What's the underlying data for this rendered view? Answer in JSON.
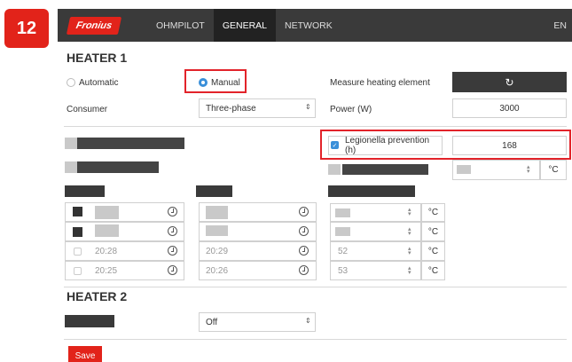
{
  "step_number": "12",
  "nav": {
    "logo": "Fronius",
    "tabs": [
      "OHMPILOT",
      "GENERAL",
      "NETWORK"
    ],
    "active_tab": "GENERAL",
    "language": "EN"
  },
  "heater1": {
    "title": "HEATER 1",
    "mode_automatic_label": "Automatic",
    "mode_manual_label": "Manual",
    "selected_mode": "Manual",
    "measure_label": "Measure heating element",
    "consumer_label": "Consumer",
    "consumer_value": "Three-phase",
    "power_label": "Power (W)",
    "power_value": "3000",
    "legionella_label": "Legionella prevention (h)",
    "legionella_value": "168",
    "temp_unit": "°C",
    "time_rows": [
      {
        "col1": "",
        "col2": "",
        "temp": ""
      },
      {
        "col1": "",
        "col2": "",
        "temp": ""
      },
      {
        "col1": "20:28",
        "col2": "20:29",
        "temp": "52"
      },
      {
        "col1": "20:25",
        "col2": "20:26",
        "temp": "53"
      }
    ]
  },
  "heater2": {
    "title": "HEATER 2",
    "select_value": "Off"
  },
  "save_label": "Save",
  "colors": {
    "accent_red": "#e2231a",
    "nav_dark": "#3a3a3a",
    "radio_blue": "#3a8fd9"
  }
}
